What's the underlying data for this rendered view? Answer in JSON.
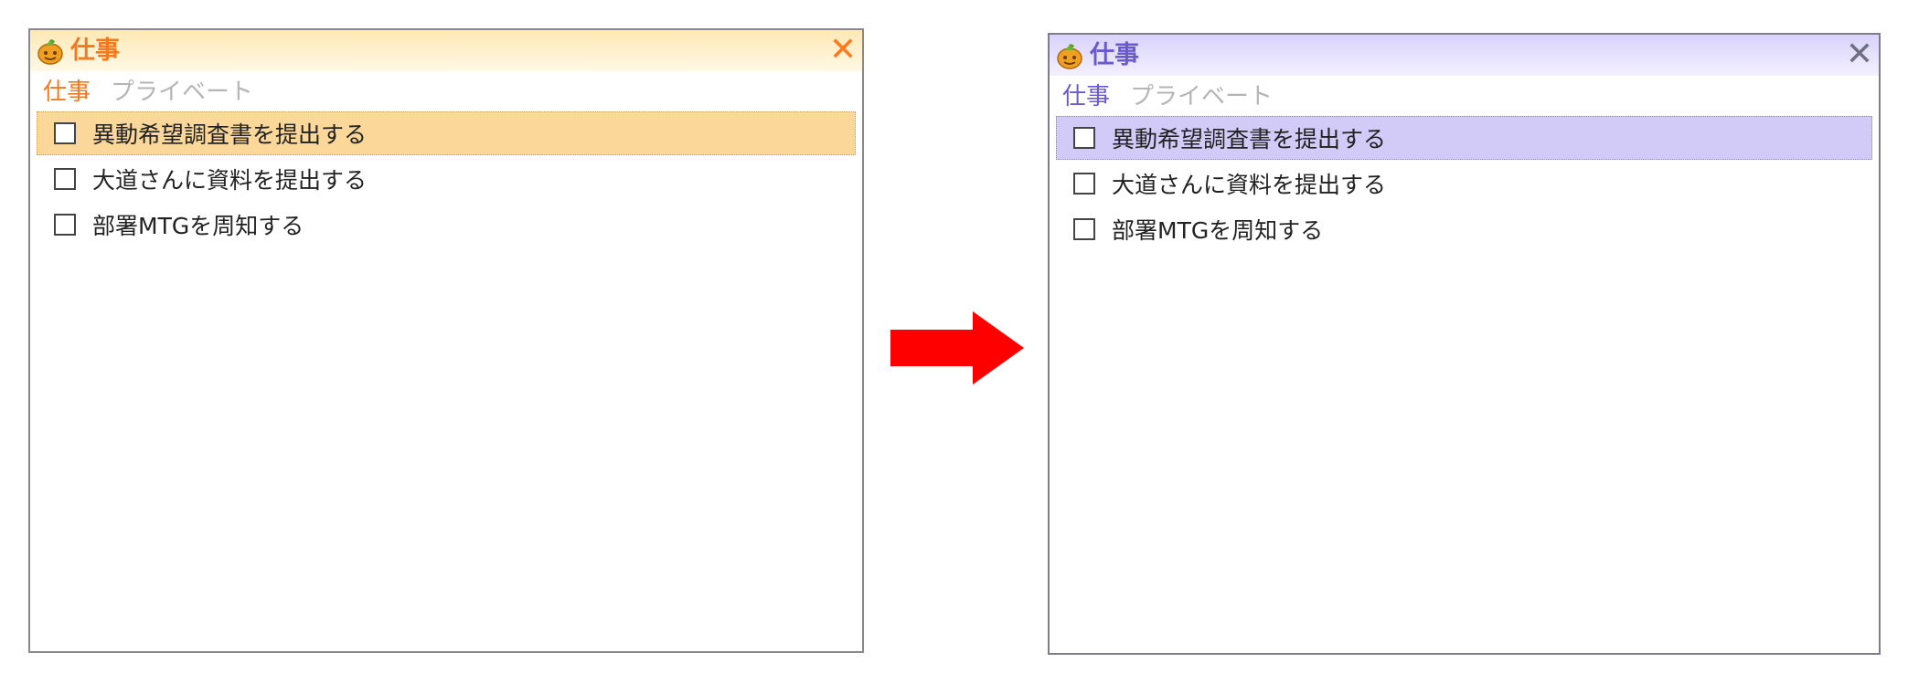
{
  "left_window": {
    "title": "仕事",
    "close": "✕",
    "tabs": [
      {
        "label": "仕事",
        "active": true
      },
      {
        "label": "プライベート",
        "active": false
      }
    ],
    "items": [
      {
        "label": "異動希望調査書を提出する",
        "checked": false,
        "selected": true
      },
      {
        "label": "大道さんに資料を提出する",
        "checked": false,
        "selected": false
      },
      {
        "label": "部署MTGを周知する",
        "checked": false,
        "selected": false
      }
    ],
    "theme": {
      "accent": "#f07a22",
      "selection": "#fbd89a"
    }
  },
  "right_window": {
    "title": "仕事",
    "close": "✕",
    "tabs": [
      {
        "label": "仕事",
        "active": true
      },
      {
        "label": "プライベート",
        "active": false
      }
    ],
    "items": [
      {
        "label": "異動希望調査書を提出する",
        "checked": false,
        "selected": true
      },
      {
        "label": "大道さんに資料を提出する",
        "checked": false,
        "selected": false
      },
      {
        "label": "部署MTGを周知する",
        "checked": false,
        "selected": false
      }
    ],
    "theme": {
      "accent": "#6a5acd",
      "selection": "#d2cbf8"
    }
  },
  "transition_arrow": {
    "icon": "right-arrow-icon",
    "color": "#ff0000"
  }
}
